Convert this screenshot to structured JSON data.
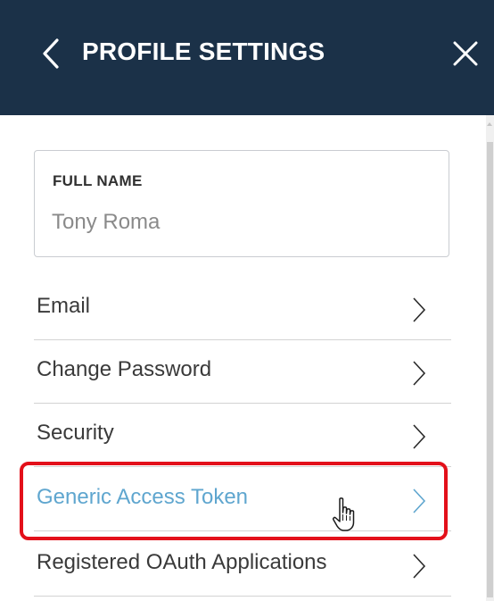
{
  "header": {
    "title": "PROFILE SETTINGS",
    "back_icon": "chevron-left-icon",
    "close_icon": "close-icon",
    "background": "#1b3148"
  },
  "full_name": {
    "label": "FULL NAME",
    "value": "Tony Roma"
  },
  "menu": {
    "items": [
      {
        "label": "Email",
        "icon": "chevron-right-icon"
      },
      {
        "label": "Change Password",
        "icon": "chevron-right-icon"
      },
      {
        "label": "Security",
        "icon": "chevron-right-icon"
      },
      {
        "label": "Generic Access Token",
        "icon": "chevron-right-icon",
        "highlighted": true
      },
      {
        "label": "Registered OAuth Applications",
        "icon": "chevron-right-icon"
      }
    ]
  },
  "colors": {
    "highlight_border": "#e3101a",
    "active_text": "#5fa6cf",
    "text": "#3a3a3a"
  }
}
